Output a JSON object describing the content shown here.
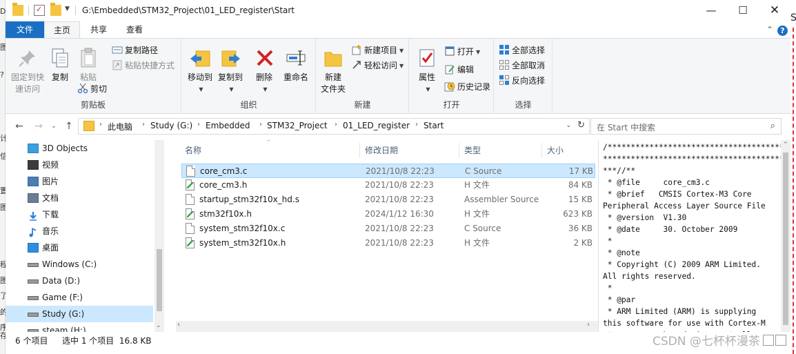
{
  "window": {
    "title_path": "G:\\Embedded\\STM32_Project\\01_LED_register\\Start"
  },
  "tabs": {
    "file": "文件",
    "home": "主页",
    "share": "共享",
    "view": "查看"
  },
  "ribbon": {
    "clipboard": {
      "label": "剪贴板",
      "pin": "固定到快速访问",
      "pin_line1": "固定到快",
      "pin_line2": "速访问",
      "copy": "复制",
      "paste": "粘贴",
      "copy_path": "复制路径",
      "paste_shortcut": "粘贴快捷方式",
      "cut": "剪切"
    },
    "organize": {
      "label": "组织",
      "move_to": "移动到",
      "copy_to": "复制到",
      "delete": "删除",
      "rename": "重命名"
    },
    "new": {
      "label": "新建",
      "new_folder_line1": "新建",
      "new_folder_line2": "文件夹",
      "new_item": "新建项目",
      "easy_access": "轻松访问"
    },
    "open": {
      "label": "打开",
      "properties": "属性",
      "open": "打开",
      "edit": "编辑",
      "history": "历史记录"
    },
    "select": {
      "label": "选择",
      "select_all": "全部选择",
      "select_none": "全部取消",
      "invert": "反向选择"
    }
  },
  "address": {
    "crumbs": [
      "此电脑",
      "Study (G:)",
      "Embedded",
      "STM32_Project",
      "01_LED_register",
      "Start"
    ],
    "search_placeholder": "在 Start 中搜索"
  },
  "nav": {
    "items": [
      {
        "label": "3D Objects",
        "icon": "3d-objects-icon"
      },
      {
        "label": "视频",
        "icon": "video-icon"
      },
      {
        "label": "图片",
        "icon": "pictures-icon"
      },
      {
        "label": "文档",
        "icon": "documents-icon"
      },
      {
        "label": "下载",
        "icon": "download-icon"
      },
      {
        "label": "音乐",
        "icon": "music-icon"
      },
      {
        "label": "桌面",
        "icon": "desktop-icon"
      },
      {
        "label": "Windows (C:)",
        "icon": "drive-icon"
      },
      {
        "label": "Data (D:)",
        "icon": "drive-icon"
      },
      {
        "label": "Game (F:)",
        "icon": "drive-icon"
      },
      {
        "label": "Study (G:)",
        "icon": "drive-icon"
      },
      {
        "label": "steam (H:)",
        "icon": "drive-icon"
      }
    ],
    "selected_index": 10
  },
  "list": {
    "columns": {
      "name": "名称",
      "date": "修改日期",
      "type": "类型",
      "size": "大小"
    },
    "rows": [
      {
        "name": "core_cm3.c",
        "date": "2021/10/8 22:23",
        "type": "C Source",
        "size": "17 KB",
        "icon": "c-file-icon"
      },
      {
        "name": "core_cm3.h",
        "date": "2021/10/8 22:23",
        "type": "H 文件",
        "size": "84 KB",
        "icon": "h-file-icon"
      },
      {
        "name": "startup_stm32f10x_hd.s",
        "date": "2021/10/8 22:23",
        "type": "Assembler Source",
        "size": "15 KB",
        "icon": "asm-file-icon"
      },
      {
        "name": "stm32f10x.h",
        "date": "2024/1/12 16:30",
        "type": "H 文件",
        "size": "623 KB",
        "icon": "h-file-icon"
      },
      {
        "name": "system_stm32f10x.c",
        "date": "2021/10/8 22:23",
        "type": "C Source",
        "size": "36 KB",
        "icon": "c-file-icon"
      },
      {
        "name": "system_stm32f10x.h",
        "date": "2021/10/8 22:23",
        "type": "H 文件",
        "size": "2 KB",
        "icon": "h-file-icon"
      }
    ],
    "selected_index": 0
  },
  "preview": {
    "text": "/*********************************************\n****************************************\n***//**\n * @file     core_cm3.c\n * @brief   CMSIS Cortex-M3 Core\nPeripheral Access Layer Source File\n * @version  V1.30\n * @date     30. October 2009\n *\n * @note\n * Copyright (C) 2009 ARM Limited.\nAll rights reserved.\n *\n * @par\n * ARM Limited (ARM) is supplying\nthis software for use with Cortex-M\n * processor based microcontrollers."
  },
  "status": {
    "count": "6 个项目",
    "selection": "选中 1 个项目  16.8 KB"
  },
  "watermark": "CSDN @七杯杯漫茶",
  "left_edge_glyphs": [
    "D",
    "图",
    "?",
    "计",
    "信",
    "置",
    "图",
    "程",
    "图",
    "了",
    "的",
    "序",
    "存"
  ],
  "right_edge_glyph": "S"
}
